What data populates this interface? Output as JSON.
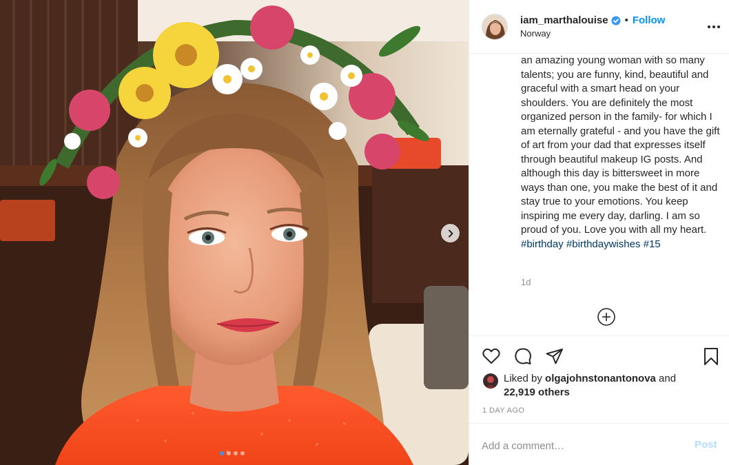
{
  "header": {
    "username": "iam_marthalouise",
    "separator": "•",
    "follow_label": "Follow",
    "location": "Norway"
  },
  "caption": {
    "text": "an amazing young woman with so many talents; you are funny, kind, beautiful and graceful with a smart head on your shoulders. You are definitely the most organized person in the family- for which I am eternally grateful - and you have the gift of art from your dad that expresses itself through beautiful makeup IG posts. And although this day is bittersweet in more ways than one, you make the best of it and stay true to your emotions. You keep inspiring me every day, darling. I am so proud of you. Love you with all my heart.",
    "hashtags": [
      "#birthday",
      "#birthdaywishes",
      "#15"
    ],
    "time_ago": "1d"
  },
  "likes": {
    "prefix": "Liked by",
    "liker": "olgajohnstonantonova",
    "conjunction": "and",
    "others": "22,919 others"
  },
  "date": "1 DAY AGO",
  "comment": {
    "placeholder": "Add a comment…",
    "post_label": "Post"
  },
  "carousel": {
    "slide_count": 4,
    "active_index": 0
  },
  "colors": {
    "accent_blue": "#0095f6",
    "verified_blue": "#3897f0",
    "post_disabled": "#b2dffc",
    "hashtag": "#00376b"
  },
  "icons": [
    "verified-badge-icon",
    "more-options-icon",
    "add-circle-icon",
    "heart-icon",
    "comment-icon",
    "share-icon",
    "bookmark-icon",
    "chevron-right-icon"
  ]
}
